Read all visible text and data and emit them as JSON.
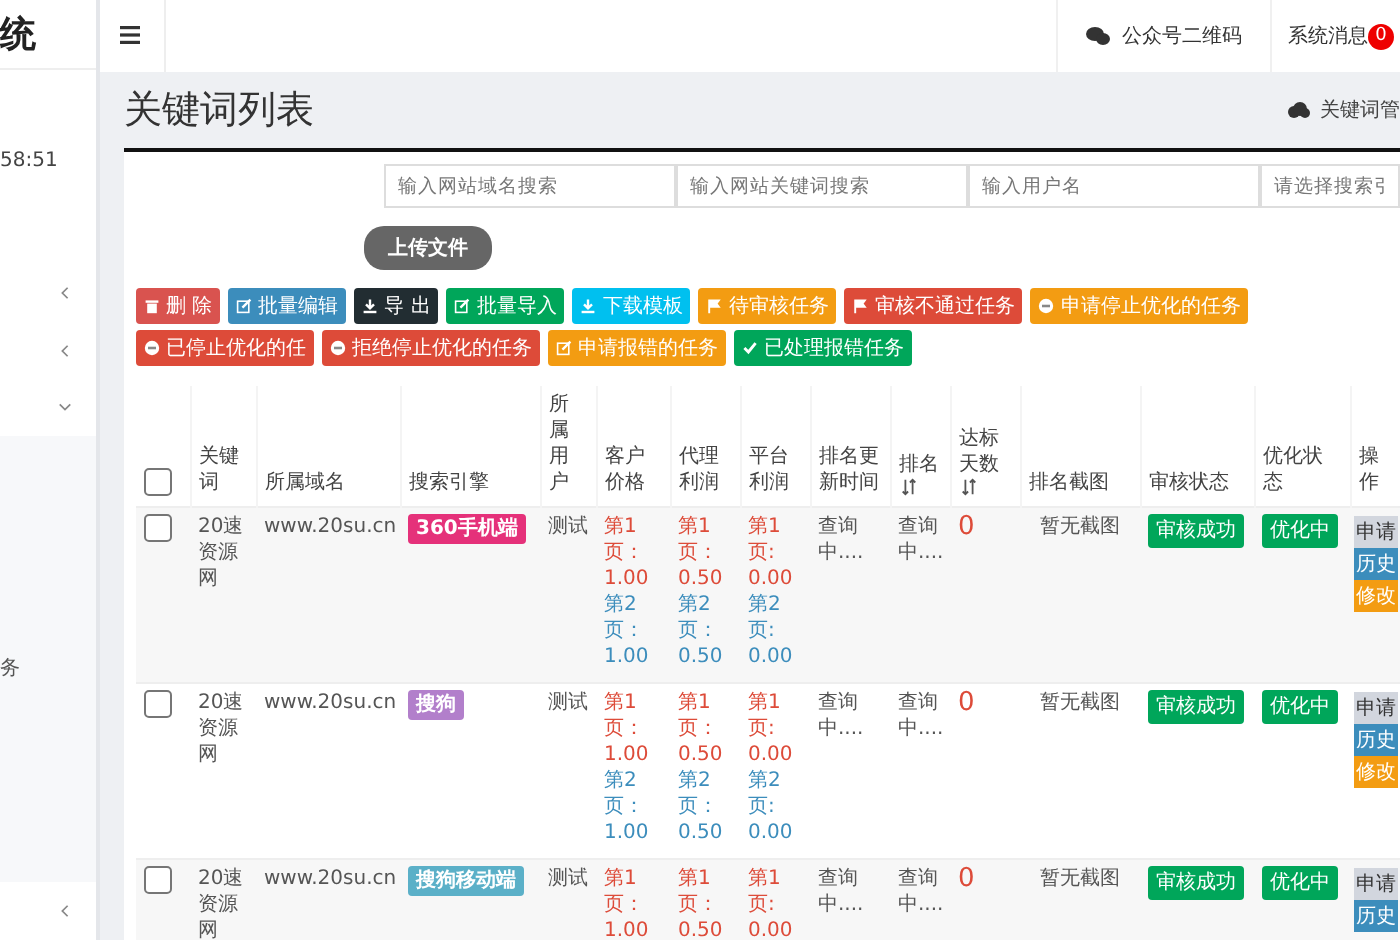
{
  "sidebar": {
    "title": "统",
    "clock": "58:51",
    "items": [
      {
        "expanded": false
      },
      {
        "expanded": false
      },
      {
        "expanded": true,
        "children": [
          {
            "label": "务"
          }
        ]
      },
      {
        "expanded": false
      }
    ]
  },
  "topbar": {
    "wechat": "公众号二维码",
    "messages": "系统消息",
    "message_count": "0"
  },
  "page": {
    "title": "关键词列表",
    "breadcrumb": "关键词管"
  },
  "filters": [
    {
      "placeholder": "输入网站域名搜索"
    },
    {
      "placeholder": "输入网站关键词搜索"
    },
    {
      "placeholder": "输入用户名"
    },
    {
      "placeholder": "请选择搜索引"
    }
  ],
  "upload_button": "上传文件",
  "action_buttons": [
    {
      "label": "删 除",
      "kind": "delete",
      "color": "#d9534f"
    },
    {
      "label": "批量编辑",
      "kind": "edit",
      "color": "#3c8dbc"
    },
    {
      "label": "导 出",
      "kind": "download",
      "color": "#222d32"
    },
    {
      "label": "批量导入",
      "kind": "edit",
      "color": "#00a65a"
    },
    {
      "label": "下载模板",
      "kind": "download",
      "color": "#00c0ef"
    },
    {
      "label": "待审核任务",
      "kind": "flag",
      "color": "#f39c12"
    },
    {
      "label": "审核不通过任务",
      "kind": "flag",
      "color": "#dd4b39"
    },
    {
      "label": "申请停止优化的任务",
      "kind": "stop",
      "color": "#f39c12"
    },
    {
      "label": "已停止优化的任",
      "kind": "stop",
      "color": "#dd4b39"
    },
    {
      "label": "拒绝停止优化的任务",
      "kind": "stop",
      "color": "#dd4b39"
    },
    {
      "label": "申请报错的任务",
      "kind": "edit",
      "color": "#f39c12"
    },
    {
      "label": "已处理报错任务",
      "kind": "check",
      "color": "#00a65a"
    }
  ],
  "table": {
    "select_all": {
      "checked": false
    },
    "columns": [
      {
        "label": "关键词"
      },
      {
        "label": "所属域名"
      },
      {
        "label": "搜索引擎"
      },
      {
        "label": "所属用户"
      },
      {
        "label": "客户价格"
      },
      {
        "label": "代理利润"
      },
      {
        "label": "平台利润"
      },
      {
        "label": "排名更新时间"
      },
      {
        "label": "排名",
        "sortable": true
      },
      {
        "label": "达标天数",
        "sortable": true
      },
      {
        "label": "排名截图"
      },
      {
        "label": "审核状态"
      },
      {
        "label": "优化状态"
      },
      {
        "label": "操作"
      }
    ],
    "rows": [
      {
        "checked": false,
        "keyword": "20速资源网",
        "domain": "www.20su.cn",
        "engine": {
          "label": "360手机端",
          "color": "#e5317a"
        },
        "user": "测试",
        "client_price": [
          {
            "label": "第1页：",
            "value": "1.00",
            "color": "#dd4b39"
          },
          {
            "label": "第2页：",
            "value": "1.00",
            "color": "#3c8dbc"
          }
        ],
        "agent_profit": [
          {
            "label": "第1页：",
            "value": "0.50",
            "color": "#dd4b39"
          },
          {
            "label": "第2页：",
            "value": "0.50",
            "color": "#3c8dbc"
          }
        ],
        "platform_profit": [
          {
            "label": "第1页:",
            "value": "0.00",
            "color": "#dd4b39"
          },
          {
            "label": "第2页:",
            "value": "0.00",
            "color": "#3c8dbc"
          }
        ],
        "update_time": "查询中....",
        "rank": "查询中....",
        "days": "0",
        "screenshot": "暂无截图",
        "audit": "审核成功",
        "optimize": "优化中",
        "ops": [
          {
            "label": "申请",
            "color": "#d2d6de"
          },
          {
            "label": "历史",
            "color": "#3c8dbc"
          },
          {
            "label": "修改",
            "color": "#f39c12"
          }
        ]
      },
      {
        "checked": false,
        "keyword": "20速资源网",
        "domain": "www.20su.cn",
        "engine": {
          "label": "搜狗",
          "color": "#b27fcb"
        },
        "user": "测试",
        "client_price": [
          {
            "label": "第1页：",
            "value": "1.00",
            "color": "#dd4b39"
          },
          {
            "label": "第2页：",
            "value": "1.00",
            "color": "#3c8dbc"
          }
        ],
        "agent_profit": [
          {
            "label": "第1页：",
            "value": "0.50",
            "color": "#dd4b39"
          },
          {
            "label": "第2页：",
            "value": "0.50",
            "color": "#3c8dbc"
          }
        ],
        "platform_profit": [
          {
            "label": "第1页:",
            "value": "0.00",
            "color": "#dd4b39"
          },
          {
            "label": "第2页:",
            "value": "0.00",
            "color": "#3c8dbc"
          }
        ],
        "update_time": "查询中....",
        "rank": "查询中....",
        "days": "0",
        "screenshot": "暂无截图",
        "audit": "审核成功",
        "optimize": "优化中",
        "ops": [
          {
            "label": "申请",
            "color": "#d2d6de"
          },
          {
            "label": "历史",
            "color": "#3c8dbc"
          },
          {
            "label": "修改",
            "color": "#f39c12"
          }
        ]
      },
      {
        "checked": false,
        "keyword": "20速资源网",
        "domain": "www.20su.cn",
        "engine": {
          "label": "搜狗移动端",
          "color": "#5bb0c8"
        },
        "user": "测试",
        "client_price": [
          {
            "label": "第1页：",
            "value": "1.00",
            "color": "#dd4b39"
          }
        ],
        "agent_profit": [
          {
            "label": "第1页：",
            "value": "0.50",
            "color": "#dd4b39"
          }
        ],
        "platform_profit": [
          {
            "label": "第1页:",
            "value": "0.00",
            "color": "#dd4b39"
          }
        ],
        "update_time": "查询中....",
        "rank": "查询中....",
        "days": "0",
        "screenshot": "暂无截图",
        "audit": "审核成功",
        "optimize": "优化中",
        "ops": [
          {
            "label": "申请",
            "color": "#d2d6de"
          },
          {
            "label": "历史",
            "color": "#3c8dbc"
          }
        ]
      }
    ]
  }
}
